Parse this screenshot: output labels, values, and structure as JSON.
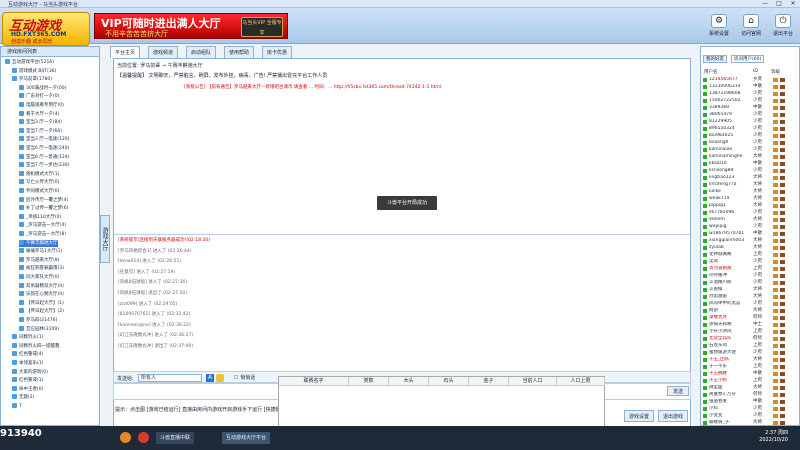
{
  "window": {
    "title": "互动游戏大厅 - 马当头游戏平台",
    "min": "—",
    "max": "□",
    "close": "✕"
  },
  "logo": {
    "line1": "互动游戏",
    "line2": "HD.FXT365.COM",
    "line3": "创造乐趣 成长同乐"
  },
  "banner": {
    "line1": "VIP可随时进出满人大厅",
    "line2": "不用辛苦苦苦挤大厅",
    "badge": "马当头VIP 全服专享"
  },
  "top_buttons": [
    {
      "label": "系统设置",
      "icon": "gear-icon",
      "glyph": "⚙"
    },
    {
      "label": "访问官网",
      "icon": "home-icon",
      "glyph": "⌂"
    },
    {
      "label": "退出平台",
      "icon": "exit-icon",
      "glyph": "⏻"
    }
  ],
  "left_panel": {
    "header": "游戏房间列表",
    "items": [
      {
        "label": "互动游戏平台(5216)",
        "indent": 0
      },
      {
        "label": "游戏模式 B0T(36)",
        "indent": 1
      },
      {
        "label": "罗马前辈(1780)",
        "indent": 1
      },
      {
        "label": "300满战时一夕(00)",
        "indent": 2
      },
      {
        "label": "广东对打一夕(0)",
        "indent": 2
      },
      {
        "label": "电脑观看专用厅(0)",
        "indent": 2
      },
      {
        "label": "看于大厅一夕(4)",
        "indent": 2
      },
      {
        "label": "室当3 厅一夕(84)",
        "indent": 2
      },
      {
        "label": "室当7 厅一夕(66)",
        "indent": 2
      },
      {
        "label": "室当3 厅一电速(120)",
        "indent": 2
      },
      {
        "label": "室当6 厅一电速(240)",
        "indent": 2
      },
      {
        "label": "室当6 厅一普通(124)",
        "indent": 2
      },
      {
        "label": "室当7 厅一步达(230)",
        "indent": 2
      },
      {
        "label": "随机模式大厅(1)",
        "indent": 2
      },
      {
        "label": "写亡火传大厅(0)",
        "indent": 2
      },
      {
        "label": "乔同模式大厅(0)",
        "indent": 2
      },
      {
        "label": "后外传厅一覆之梦(4)",
        "indent": 2
      },
      {
        "label": "补丁过传一覆之梦(6)",
        "indent": 2
      },
      {
        "label": "_单挑110大厅(0)",
        "indent": 2
      },
      {
        "label": "_罗马游击一大厅(4)",
        "indent": 2
      },
      {
        "label": "_罗马游击一大厅(8)",
        "indent": 2
      },
      {
        "label": "午赛丰麒驰大厅",
        "indent": 2,
        "selected": true
      },
      {
        "label": "痛痛罗马1大厅(1)",
        "indent": 2
      },
      {
        "label": "罗马越来大厅(8)",
        "indent": 2
      },
      {
        "label": "疯狂刺客罪霸落(3)",
        "indent": 2
      },
      {
        "label": "同大家队大厅(0)",
        "indent": 2
      },
      {
        "label": "双吊器颗双大厅(4)",
        "indent": 2
      },
      {
        "label": "乐韵在心剩大厅(4)",
        "indent": 2
      },
      {
        "label": "【传日起大厅】(1)",
        "indent": 2
      },
      {
        "label": "【传日起大厅】(2)",
        "indent": 2
      },
      {
        "label": "罗马四(21476)",
        "indent": 2
      },
      {
        "label": "宫应园林(3109)",
        "indent": 2
      },
      {
        "label": "同颗烈火(1)",
        "indent": 1
      },
      {
        "label": "同颗烈火四一提醒鑫",
        "indent": 1
      },
      {
        "label": "红色警戒(4)",
        "indent": 1
      },
      {
        "label": "本领宴乐(1)",
        "indent": 1
      },
      {
        "label": "大家的游戏(0)",
        "indent": 1
      },
      {
        "label": "红色警戒(1)",
        "indent": 1
      },
      {
        "label": "命中王者(0)",
        "indent": 1
      },
      {
        "label": "无题(2)",
        "indent": 1
      },
      {
        "label": "7",
        "indent": 1
      }
    ]
  },
  "game_tab": "游戏大厅",
  "tabs": [
    "平台主页",
    "游戏频道",
    "启动组队",
    "使用帮助",
    "房卡优惠"
  ],
  "main": {
    "breadcrumb": "当前位置: 罗马前辈 → 午赛丰麒驰大厅",
    "notice": "【温馨提醒】 文明聊天，严禁脏言，刷屏，发布外挂，病毒，广告! 严禁播出冒充平台工作人员",
    "red_line": "[系统公告] 【前有通告】罗马越来大厅—新增吧台演示 请查看 ... 时间：... http://h5sbx.fxt365.com/thread-74342-1-1.html",
    "toast": "斗兽平台开局成功",
    "chat": [
      {
        "text": "[系统提示]连接到天联服务器成功!(02:18:30)",
        "red": true
      },
      {
        "text": "[罗马风格综合1] 进入了 (02:26:44)",
        "red": false
      },
      {
        "text": "[tevw014] 进入了 (02:26:51)",
        "red": false
      },
      {
        "text": "[任意见] 进入了 (02:27:19)",
        "red": false
      },
      {
        "text": "[风帆8伍球船] 进入了 (02:27:36)",
        "red": false
      },
      {
        "text": "[风帆8伍球船] 退出了 (02:27:50)",
        "red": false
      },
      {
        "text": "[zizi099] 进入了 (02:29:05)",
        "red": false
      },
      {
        "text": "[8109570761] 进入了 (02:32:42)",
        "red": false
      },
      {
        "text": "[kaminengine] 进入了 (02:36:22)",
        "red": false
      },
      {
        "text": "[幻江东隆数丸冲] 进入了 (02:36:27)",
        "red": false
      },
      {
        "text": "[幻江东隆数丸冲] 退出了 (02:37:00)",
        "red": false
      }
    ],
    "send_label": "发送给:",
    "send_target": "所有人",
    "secret_label": "悄悄话",
    "send_button": "发送",
    "hint": "提示：点击图 [游戏已结运行] 直接由房间内游戏开启游戏手下运行 [快捷键]",
    "settings_button": "游戏设置",
    "exit_button": "退出游戏"
  },
  "game_table": {
    "headers": [
      "联赛名字",
      "类数",
      "木头",
      "石头",
      "金子",
      "当前人口",
      "人口上限"
    ]
  },
  "right_panel": {
    "tabs": [
      "我的好友",
      "房间用户(60)"
    ],
    "columns": [
      "用户名",
      "ID",
      "等级"
    ],
    "users": [
      {
        "name": "1234565677",
        "level": "乡贤",
        "red": true
      },
      {
        "name": "13230006314",
        "level": "中散"
      },
      {
        "name": "13871198608",
        "level": "少府"
      },
      {
        "name": "15002722502",
        "level": "少府"
      },
      {
        "name": "3389369",
        "level": "中散"
      },
      {
        "name": "38065479",
        "level": "少府"
      },
      {
        "name": "81229905",
        "level": "少府"
      },
      {
        "name": "896550324",
        "level": "少府"
      },
      {
        "name": "biu983025",
        "level": "少府"
      },
      {
        "name": "bailongfi",
        "level": "少府"
      },
      {
        "name": "kaminaiax",
        "level": "少府"
      },
      {
        "name": "kaminaminghe",
        "level": "大将"
      },
      {
        "name": "kkaal10",
        "level": "中散"
      },
      {
        "name": "lisnilong89",
        "level": "少府"
      },
      {
        "name": "lingtiao123",
        "level": "大将"
      },
      {
        "name": "lirrufeng77a",
        "level": "大将"
      },
      {
        "name": "lulike",
        "level": "大将"
      },
      {
        "name": "weak714",
        "level": "大将"
      },
      {
        "name": "pippig1",
        "level": "大将"
      },
      {
        "name": "s67785096",
        "level": "少府"
      },
      {
        "name": "skslem",
        "level": "大将"
      },
      {
        "name": "wepipig",
        "level": "少府"
      },
      {
        "name": "w18679570761",
        "level": "中散"
      },
      {
        "name": "xiangqianm003",
        "level": "大将"
      },
      {
        "name": "zyulab",
        "level": "大将"
      },
      {
        "name": "化神城阁阁",
        "level": "上府"
      },
      {
        "name": "淫商",
        "level": "少府",
        "red": true
      },
      {
        "name": "等河道跑跑",
        "level": "上府",
        "red": true
      },
      {
        "name": "尽丹缓冲",
        "level": "少府"
      },
      {
        "name": "斗酒精川郎",
        "level": "少府"
      },
      {
        "name": "斗兽棋",
        "level": "大将"
      },
      {
        "name": "烈焰滋雷",
        "level": "大将"
      },
      {
        "name": "风同体中的黑篮",
        "level": "少府"
      },
      {
        "name": "网游",
        "level": "大将"
      },
      {
        "name": "渐缠太月",
        "level": "何师",
        "red": true
      },
      {
        "name": "渗骑天和啊",
        "level": "中士"
      },
      {
        "name": "学长小诗风",
        "level": "上府"
      },
      {
        "name": "无双全兵队",
        "level": "何师",
        "red": true
      },
      {
        "name": "石左东风",
        "level": "上府"
      },
      {
        "name": "蜜频级游大使",
        "level": "少府"
      },
      {
        "name": "千王_团队",
        "level": "大将",
        "red": true
      },
      {
        "name": "于一不乐",
        "level": "上府"
      },
      {
        "name": "千王摘腰",
        "level": "中散",
        "red": true
      },
      {
        "name": "千王小狗",
        "level": "上府",
        "red": true
      },
      {
        "name": "微型面",
        "level": "大将"
      },
      {
        "name": "简厦想1.万分",
        "level": "何师"
      },
      {
        "name": "强盗吞发",
        "level": "中散"
      },
      {
        "name": "小科",
        "level": "少府"
      },
      {
        "name": "小变变",
        "level": "少府"
      },
      {
        "name": "最晚骑_子",
        "level": "大将"
      }
    ]
  },
  "taskbar": {
    "items": [
      "斗兽直播中联",
      "互动游戏大厅平台"
    ],
    "time": "2:37 周四",
    "date": "2022/10/20",
    "overlay": "913940"
  },
  "colors": {
    "accent": "#3a78d8",
    "panel_border": "#8fb0d4",
    "red": "#c00000"
  }
}
